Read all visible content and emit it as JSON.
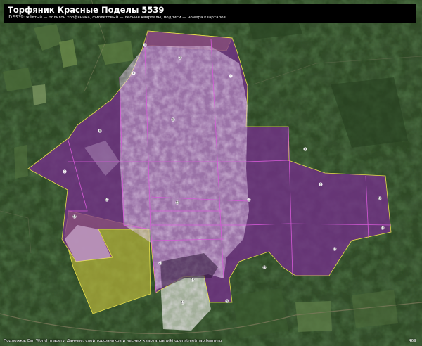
{
  "map": {
    "title": "Торфяник Красные Поделы 5539",
    "subtitle": "ID 5539: жёлтый — полигон торфяника, фиолетовый — лесные кварталы, подписи — номера кварталов",
    "attribution": "Подложка: Esri World Imagery. Данные: слой торфяников и лесных кварталов wiki.openstreetmap.team-ru",
    "page_number": "469",
    "basemap": "satellite imagery",
    "colors": {
      "peatland_outline": "#e8e04a",
      "peatland_fill": "#c9c23c",
      "forest_quarter_fill": "#7a2d93",
      "forest_quarter_outline": "#d65ad8",
      "label_marker": "#ffffff"
    },
    "quarter_labels": [
      {
        "id": "q1",
        "label": "1"
      },
      {
        "id": "q2",
        "label": "2"
      },
      {
        "id": "q3",
        "label": "3"
      },
      {
        "id": "q4",
        "label": "4"
      },
      {
        "id": "q5",
        "label": "5"
      },
      {
        "id": "q6",
        "label": "6"
      },
      {
        "id": "q7",
        "label": "7"
      },
      {
        "id": "q8",
        "label": "8"
      },
      {
        "id": "q9",
        "label": "9"
      },
      {
        "id": "q10",
        "label": "10"
      },
      {
        "id": "q11",
        "label": "11"
      },
      {
        "id": "q12",
        "label": "12"
      },
      {
        "id": "q13",
        "label": "13"
      },
      {
        "id": "q14",
        "label": "14"
      },
      {
        "id": "q15",
        "label": "15"
      },
      {
        "id": "q16",
        "label": "16"
      },
      {
        "id": "q17",
        "label": "17"
      },
      {
        "id": "q18",
        "label": "18"
      },
      {
        "id": "q19",
        "label": "19"
      },
      {
        "id": "q20",
        "label": "20"
      },
      {
        "id": "q21",
        "label": "21"
      }
    ]
  }
}
